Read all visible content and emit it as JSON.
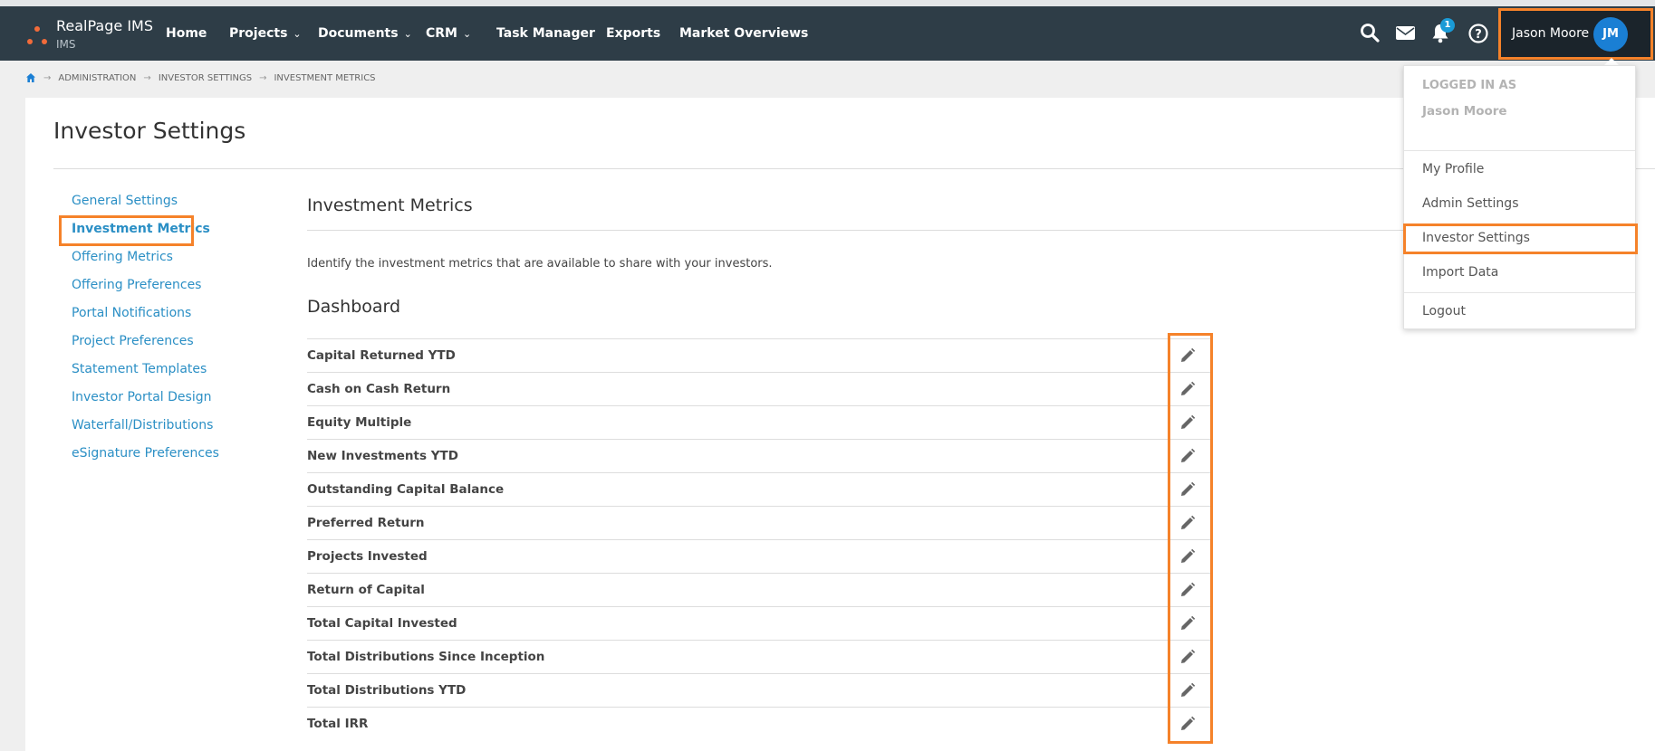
{
  "brand": {
    "name": "RealPage IMS",
    "sub": "IMS"
  },
  "nav": [
    {
      "label": "Home",
      "dropdown": false
    },
    {
      "label": "Projects",
      "dropdown": true
    },
    {
      "label": "Documents",
      "dropdown": true
    },
    {
      "label": "CRM",
      "dropdown": true
    },
    {
      "label": "Task Manager",
      "dropdown": false
    },
    {
      "label": "Exports",
      "dropdown": false
    },
    {
      "label": "Market Overviews",
      "dropdown": false
    }
  ],
  "notifications": {
    "count": "1"
  },
  "user": {
    "name": "Jason Moore",
    "initials": "JM"
  },
  "breadcrumb": [
    "ADMINISTRATION",
    "INVESTOR SETTINGS",
    "INVESTMENT METRICS"
  ],
  "page_title": "Investor Settings",
  "sidebar": [
    {
      "label": "General Settings"
    },
    {
      "label": "Investment Metrics",
      "active": true
    },
    {
      "label": "Offering Metrics"
    },
    {
      "label": "Offering Preferences"
    },
    {
      "label": "Portal Notifications"
    },
    {
      "label": "Project Preferences"
    },
    {
      "label": "Statement Templates"
    },
    {
      "label": "Investor Portal Design"
    },
    {
      "label": "Waterfall/Distributions"
    },
    {
      "label": "eSignature Preferences"
    }
  ],
  "main": {
    "section_title": "Investment Metrics",
    "description": "Identify the investment metrics that are available to share with your investors.",
    "subsection_title": "Dashboard",
    "metrics": [
      "Capital Returned YTD",
      "Cash on Cash Return",
      "Equity Multiple",
      "New Investments YTD",
      "Outstanding Capital Balance",
      "Preferred Return",
      "Projects Invested",
      "Return of Capital",
      "Total Capital Invested",
      "Total Distributions Since Inception",
      "Total Distributions YTD",
      "Total IRR"
    ]
  },
  "dropdown": {
    "header": "LOGGED IN AS",
    "user": "Jason Moore",
    "items": [
      "My Profile",
      "Admin Settings",
      "Investor Settings",
      "Import Data",
      "Logout"
    ],
    "highlighted_item": "Investor Settings"
  },
  "colors": {
    "navbar": "#2e3d47",
    "link": "#2b8fc5",
    "highlight": "#f5822a",
    "avatar": "#1a7fd4",
    "badge": "#1a9bd7",
    "logo": "#f26b3a"
  },
  "icons": {
    "home": "home-icon",
    "search": "search-icon",
    "mail": "mail-icon",
    "notifications": "bell-icon",
    "help": "help-icon",
    "edit": "pencil-icon"
  }
}
